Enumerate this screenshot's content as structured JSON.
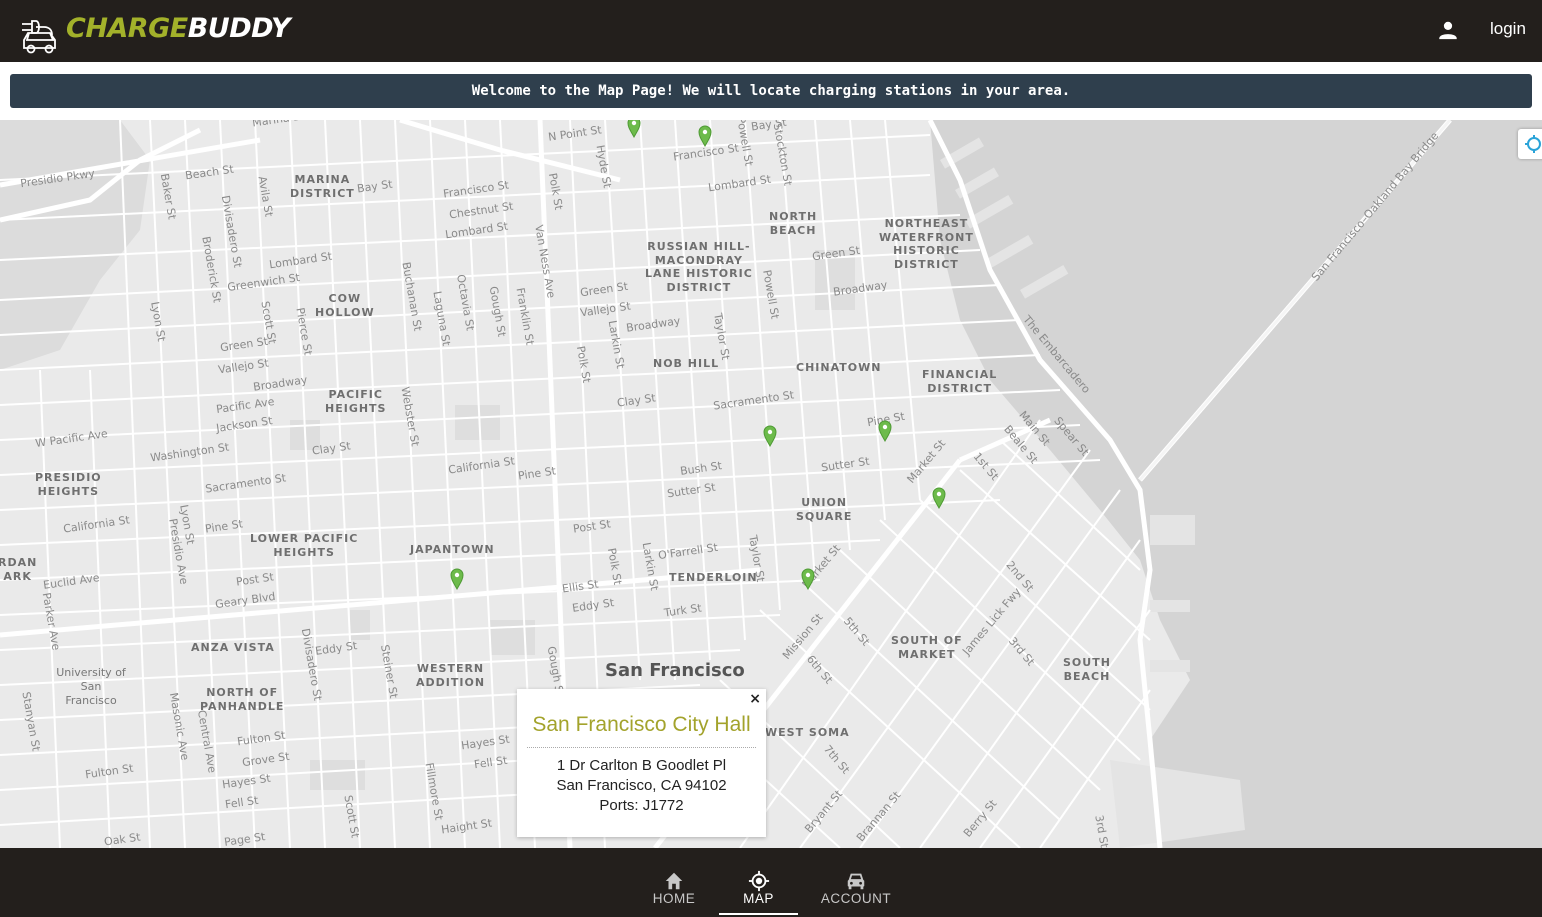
{
  "header": {
    "logo_charge": "CHARGE",
    "logo_buddy": "BUDDY",
    "login_label": "login"
  },
  "banner": {
    "text": "Welcome to the Map Page! We will locate charging stations in your area."
  },
  "map": {
    "districts": [
      "MARINA DISTRICT",
      "COW HOLLOW",
      "PACIFIC HEIGHTS",
      "PRESIDIO HEIGHTS",
      "LOWER PACIFIC HEIGHTS",
      "JAPANTOWN",
      "ANZA VISTA",
      "NORTH OF PANHANDLE",
      "WESTERN ADDITION",
      "RUSSIAN HILL-MACONDRAY LANE HISTORIC DISTRICT",
      "NOB HILL",
      "NORTH BEACH",
      "NORTHEAST WATERFRONT HISTORIC DISTRICT",
      "CHINATOWN",
      "FINANCIAL DISTRICT",
      "UNION SQUARE",
      "TENDERLOIN",
      "SOUTH OF MARKET",
      "SOUTH BEACH",
      "WEST SOMA",
      "RDAN ARK"
    ],
    "city": "San Francisco",
    "university": "University of San Francisco",
    "streets": [
      "Presidio Pkwy",
      "Beach St",
      "Bay St",
      "Francisco St",
      "Chestnut St",
      "Lombard St",
      "Greenwich St",
      "Green St",
      "Vallejo St",
      "Broadway",
      "Pacific Ave",
      "Jackson St",
      "Washington St",
      "Clay St",
      "Sacramento St",
      "California St",
      "Pine St",
      "Bush St",
      "Sutter St",
      "Post St",
      "Geary Blvd",
      "O'Farrell St",
      "Ellis St",
      "Eddy St",
      "Turk St",
      "Fulton St",
      "Grove St",
      "Hayes St",
      "Fell St",
      "Oak St",
      "Page St",
      "Haight St",
      "Market St",
      "Mission St",
      "Van Ness Ave",
      "Polk St",
      "Larkin St",
      "Hyde St",
      "Taylor St",
      "Powell St",
      "Stockton St",
      "N Point St",
      "Baker St",
      "Divisadero St",
      "Lyon St",
      "Scott St",
      "Pierce St",
      "Buchanan St",
      "Laguna St",
      "Octavia St",
      "Gough St",
      "Franklin St",
      "Webster St",
      "Steiner St",
      "Fillmore St",
      "Masonic Ave",
      "Central Ave",
      "Presidio Ave",
      "Parker Ave",
      "Stanyan St",
      "Euclid Ave",
      "W Pacific Ave",
      "Avila St",
      "Broderick St",
      "The Embarcadero",
      "Main St",
      "Beale St",
      "Spear St",
      "1st St",
      "2nd St",
      "3rd St",
      "5th St",
      "6th St",
      "7th St",
      "James Lick Fwy",
      "Bryant St",
      "Brannan St",
      "Berry St",
      "San Francisco–Oakland Bay Bridge",
      "Marina Blvd"
    ],
    "markers": 8
  },
  "popup": {
    "close": "×",
    "title": "San Francisco City Hall",
    "address_line1": "1 Dr Carlton B Goodlet Pl",
    "address_line2": "San Francisco, CA 94102",
    "ports": "Ports: J1772"
  },
  "nav": {
    "home": "HOME",
    "map": "MAP",
    "account": "ACCOUNT"
  },
  "colors": {
    "brand_green": "#a3b12a",
    "header_bg": "#231f1c",
    "banner_bg": "#2f3f4d",
    "marker_green": "#6dbb4b"
  }
}
